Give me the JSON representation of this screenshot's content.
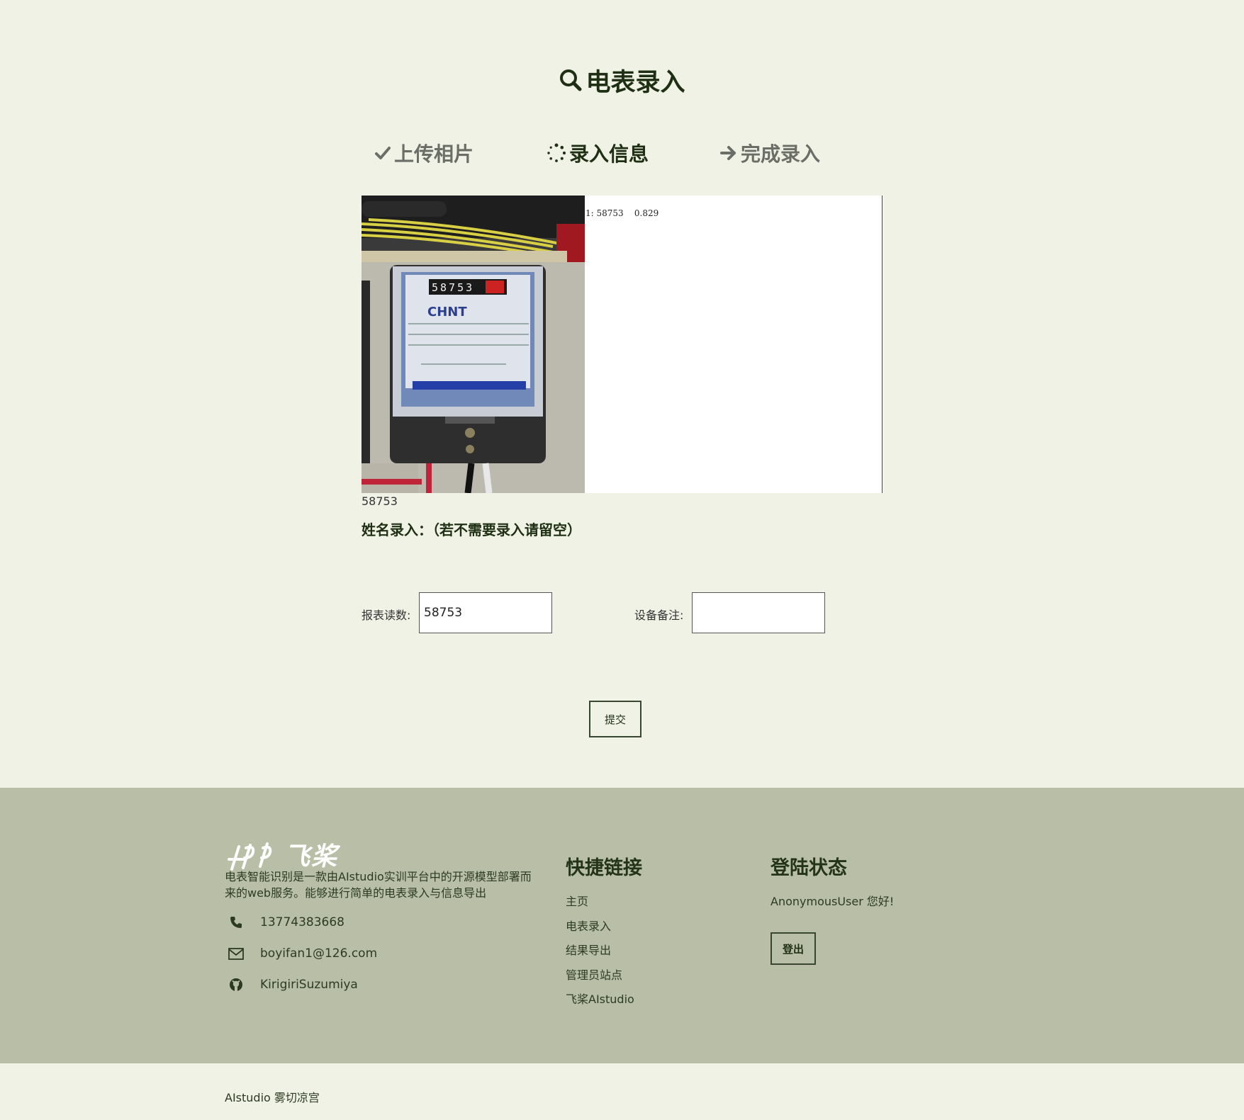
{
  "page": {
    "title": "电表录入"
  },
  "steps": [
    {
      "label": "上传相片",
      "state": "done"
    },
    {
      "label": "录入信息",
      "state": "active"
    },
    {
      "label": "完成录入",
      "state": "pending"
    }
  ],
  "recognition": {
    "ocr_line": "1: 58753    0.829",
    "reading": "58753",
    "meter_display": "58753"
  },
  "form": {
    "name_label": "姓名录入：（若不需要录入请留空）",
    "reading_label": "报表读数:",
    "reading_value": "58753",
    "note_label": "设备备注:",
    "note_value": "",
    "submit_label": "提交"
  },
  "footer": {
    "logo_text": "飞桨",
    "description": "电表智能识别是一款由AIstudio实训平台中的开源模型部署而来的web服务。能够进行简单的电表录入与信息导出",
    "phone": "13774383668",
    "email": "boyifan1@126.com",
    "github": "KirigiriSuzumiya",
    "links_title": "快捷链接",
    "links": [
      "主页",
      "电表录入",
      "结果导出",
      "管理员站点",
      "飞桨AIstudio"
    ],
    "status_title": "登陆状态",
    "status_text": "AnonymousUser 您好!",
    "logout_label": "登出",
    "copyright": "AIstudio 雾切凉宫"
  },
  "colors": {
    "background": "#eff2e4",
    "footer_background": "#b9bfa7",
    "heading": "#1f2f14"
  }
}
